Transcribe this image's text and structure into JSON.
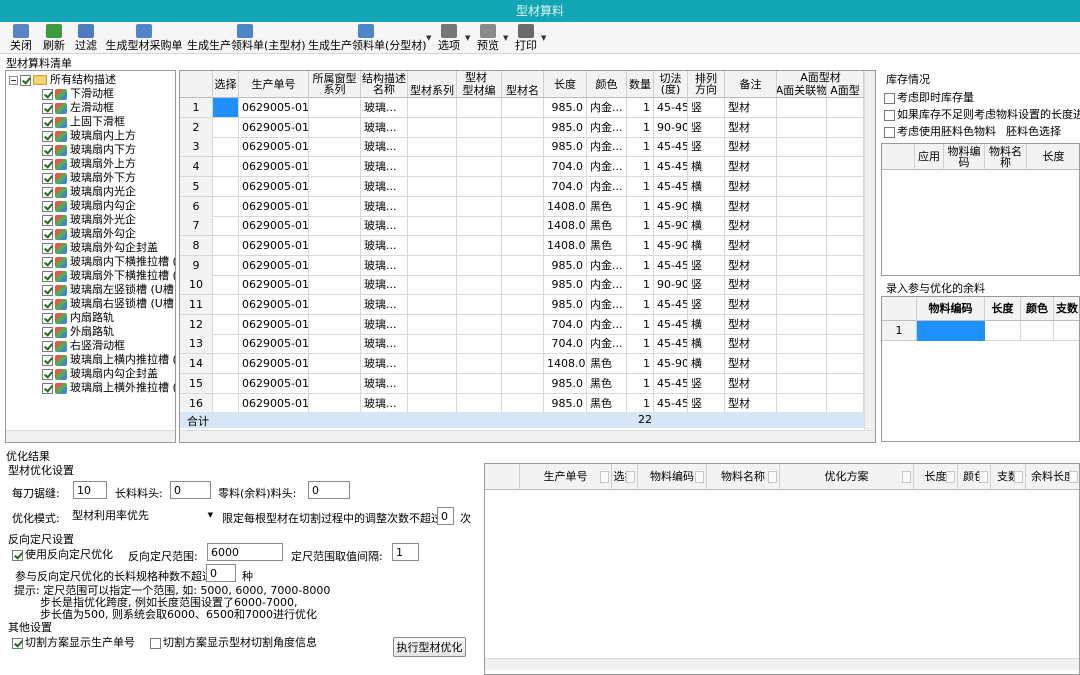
{
  "window": {
    "title": "型材算料"
  },
  "toolbar": {
    "buttons": [
      {
        "label": "关闭",
        "icon": "close-door-icon",
        "color": "#5b86c4"
      },
      {
        "label": "刷新",
        "icon": "refresh-icon",
        "color": "#3c9b3c"
      },
      {
        "label": "过滤",
        "icon": "funnel-icon",
        "color": "#4f7bc0"
      },
      {
        "label": "生成型材采购单",
        "icon": "purchase-sheet-icon",
        "color": "#4c86c9"
      },
      {
        "label": "生成生产领料单(主型材)",
        "icon": "requisition-main-icon",
        "color": "#4c86c9"
      },
      {
        "label": "生成生产领料单(分型材)",
        "icon": "requisition-sub-icon",
        "color": "#4c86c9"
      },
      {
        "label": "选项",
        "icon": "tools-icon",
        "color": "#777777"
      },
      {
        "label": "预览",
        "icon": "preview-icon",
        "color": "#8a8a8a"
      },
      {
        "label": "打印",
        "icon": "printer-icon",
        "color": "#6b6b6b"
      }
    ]
  },
  "section": {
    "title": "型材算料清单"
  },
  "tree": {
    "root": "所有结构描述",
    "items": [
      "下滑动框",
      "左滑动框",
      "上固下滑框",
      "玻璃扇内上方",
      "玻璃扇内下方",
      "玻璃扇外上方",
      "玻璃扇外下方",
      "玻璃扇内光企",
      "玻璃扇内勾企",
      "玻璃扇外光企",
      "玻璃扇外勾企",
      "玻璃扇外勾企封盖",
      "玻璃扇内下横推拉槽 (",
      "玻璃扇外下横推拉槽 (",
      "玻璃扇左竖锁槽 (U槽)",
      "玻璃扇右竖锁槽 (U槽)",
      "内扇路轨",
      "外扇路轨",
      "右竖滑动框",
      "玻璃扇上横内推拉槽 (",
      "玻璃扇内勾企封盖",
      "玻璃扇上横外推拉槽 ("
    ]
  },
  "main_grid": {
    "headers": [
      "",
      "选择",
      "生产单号",
      "所属窗型\n系列",
      "结构描述\n名称",
      "型材系列",
      "型材编",
      "型材名",
      "长度",
      "颜色",
      "数量",
      "切法\n(度)",
      "排列\n方向",
      "备注",
      "A面关联物",
      "A面型"
    ],
    "group_headers": {
      "profile": "型材",
      "aface": "A面型材"
    },
    "rows": [
      [
        "1",
        "",
        "0629005-01",
        "",
        "玻璃...",
        "",
        "",
        "",
        "985.0",
        "内金...",
        "1",
        "45-45",
        "竖",
        "型材",
        "",
        ""
      ],
      [
        "2",
        "",
        "0629005-01",
        "",
        "玻璃...",
        "",
        "",
        "",
        "985.0",
        "内金...",
        "1",
        "90-90",
        "竖",
        "型材",
        "",
        ""
      ],
      [
        "3",
        "",
        "0629005-01",
        "",
        "玻璃...",
        "",
        "",
        "",
        "985.0",
        "内金...",
        "1",
        "45-45",
        "竖",
        "型材",
        "",
        ""
      ],
      [
        "4",
        "",
        "0629005-01",
        "",
        "玻璃...",
        "",
        "",
        "",
        "704.0",
        "内金...",
        "1",
        "45-45",
        "横",
        "型材",
        "",
        ""
      ],
      [
        "5",
        "",
        "0629005-01",
        "",
        "玻璃...",
        "",
        "",
        "",
        "704.0",
        "内金...",
        "1",
        "45-45",
        "横",
        "型材",
        "",
        ""
      ],
      [
        "6",
        "",
        "0629005-01",
        "",
        "玻璃...",
        "",
        "",
        "",
        "1408.0",
        "黑色",
        "1",
        "45-90",
        "横",
        "型材",
        "",
        ""
      ],
      [
        "7",
        "",
        "0629005-01",
        "",
        "玻璃...",
        "",
        "",
        "",
        "1408.0",
        "黑色",
        "1",
        "45-90",
        "横",
        "型材",
        "",
        ""
      ],
      [
        "8",
        "",
        "0629005-01",
        "",
        "玻璃...",
        "",
        "",
        "",
        "1408.0",
        "黑色",
        "1",
        "45-90",
        "横",
        "型材",
        "",
        ""
      ],
      [
        "9",
        "",
        "0629005-01",
        "",
        "玻璃...",
        "",
        "",
        "",
        "985.0",
        "内金...",
        "1",
        "45-45",
        "竖",
        "型材",
        "",
        ""
      ],
      [
        "10",
        "",
        "0629005-01",
        "",
        "玻璃...",
        "",
        "",
        "",
        "985.0",
        "内金...",
        "1",
        "90-90",
        "竖",
        "型材",
        "",
        ""
      ],
      [
        "11",
        "",
        "0629005-01",
        "",
        "玻璃...",
        "",
        "",
        "",
        "985.0",
        "内金...",
        "1",
        "45-45",
        "竖",
        "型材",
        "",
        ""
      ],
      [
        "12",
        "",
        "0629005-01",
        "",
        "玻璃...",
        "",
        "",
        "",
        "704.0",
        "内金...",
        "1",
        "45-45",
        "横",
        "型材",
        "",
        ""
      ],
      [
        "13",
        "",
        "0629005-01",
        "",
        "玻璃...",
        "",
        "",
        "",
        "704.0",
        "内金...",
        "1",
        "45-45",
        "横",
        "型材",
        "",
        ""
      ],
      [
        "14",
        "",
        "0629005-01",
        "",
        "玻璃...",
        "",
        "",
        "",
        "1408.0",
        "黑色",
        "1",
        "45-90",
        "横",
        "型材",
        "",
        ""
      ],
      [
        "15",
        "",
        "0629005-01",
        "",
        "玻璃...",
        "",
        "",
        "",
        "985.0",
        "黑色",
        "1",
        "45-45",
        "竖",
        "型材",
        "",
        ""
      ],
      [
        "16",
        "",
        "0629005-01",
        "",
        "玻璃...",
        "",
        "",
        "",
        "985.0",
        "黑色",
        "1",
        "45-45",
        "竖",
        "型材",
        "",
        ""
      ]
    ],
    "summary_label": "合计",
    "summary_qty": "22"
  },
  "inventory": {
    "title": "库存情况",
    "opt1": "考虑即时库存量",
    "opt2": "如果库存不足则考虑物料设置的长度进行",
    "opt3": "考虑使用胚料色物料",
    "blank_color_label": "胚料色选择",
    "headers": [
      "",
      "应用",
      "物料编\n码",
      "物料名\n称",
      "长度"
    ]
  },
  "leftover": {
    "title": "录入参与优化的余料",
    "headers": [
      "",
      "物料编码",
      "长度",
      "颜色",
      "支数"
    ],
    "row_num": "1"
  },
  "optimize": {
    "title": "优化结果",
    "settings_title": "型材优化设置",
    "kerf_label": "每刀锯缝:",
    "kerf_value": "10",
    "head_label": "长料料头:",
    "head_value": "0",
    "scrap_label": "零料(余料)料头:",
    "scrap_value": "0",
    "mode_label": "优化模式:",
    "mode_value": "型材利用率优先",
    "limit_label": "限定每根型材在切割过程中的调整次数不超过",
    "limit_value": "0",
    "limit_unit": "次",
    "reverse_title": "反向定尺设置",
    "use_reverse": "使用反向定尺优化",
    "range_label": "反向定尺范围:",
    "range_value": "6000",
    "step_label": "定尺范围取值间隔:",
    "step_value": "1",
    "kinds_label": "参与反向定尺优化的长料规格种数不超过",
    "kinds_value": "0",
    "kinds_unit": "种",
    "tip1": "提示: 定尺范围可以指定一个范围, 如: 5000, 6000, 7000-8000",
    "tip2": "步长是指优化跨度, 例如长度范围设置了6000-7000,",
    "tip3": "步长值为500, 则系统会取6000、6500和7000进行优化",
    "other_title": "其他设置",
    "show_order": "切割方案显示生产单号",
    "show_angle": "切割方案显示型材切割角度信息",
    "run_button": "执行型材优化"
  },
  "result_grid": {
    "headers": [
      "",
      "生产单号",
      "选择",
      "物料编码",
      "物料名称",
      "优化方案",
      "长度",
      "颜色",
      "支数",
      "余料长度"
    ]
  },
  "colors": {
    "title_bar": "#12a5b4",
    "selection": "#1e90ff",
    "summary": "#d6e6f7"
  }
}
